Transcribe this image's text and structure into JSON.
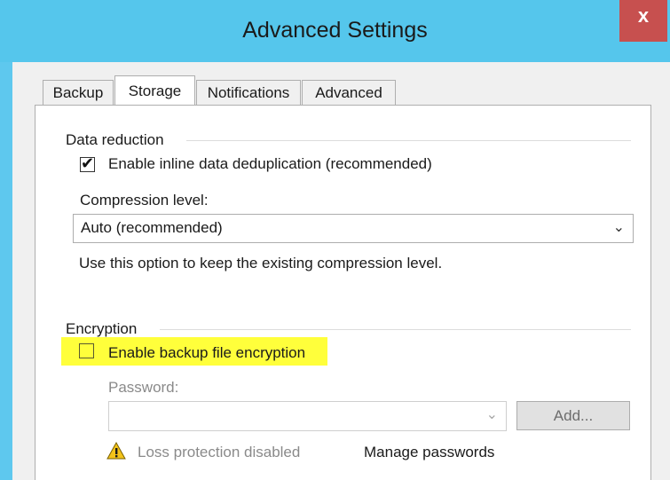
{
  "window": {
    "title": "Advanced Settings",
    "close_label": "x"
  },
  "tabs": [
    {
      "label": "Backup"
    },
    {
      "label": "Storage"
    },
    {
      "label": "Notifications"
    },
    {
      "label": "Advanced"
    }
  ],
  "data_reduction": {
    "group_label": "Data reduction",
    "dedup_label": "Enable inline data deduplication (recommended)",
    "dedup_checked": true,
    "compression_label": "Compression level:",
    "compression_value": "Auto (recommended)",
    "compression_hint": "Use this option to keep the existing compression level."
  },
  "encryption": {
    "group_label": "Encryption",
    "enable_label": "Enable backup file encryption",
    "enable_checked": false,
    "highlight_color": "#ffff3b",
    "password_label": "Password:",
    "password_value": "",
    "add_label": "Add...",
    "warning_text": "Loss protection disabled",
    "manage_label": "Manage passwords"
  },
  "colors": {
    "titlebar": "#55c6ec",
    "close": "#c7504f",
    "panel": "#ffffff",
    "chrome": "#f0f0f0"
  },
  "icons": {
    "close": "close-icon",
    "check": "checkmark-icon",
    "dropdown": "chevron-down-icon",
    "warning": "warning-icon"
  }
}
